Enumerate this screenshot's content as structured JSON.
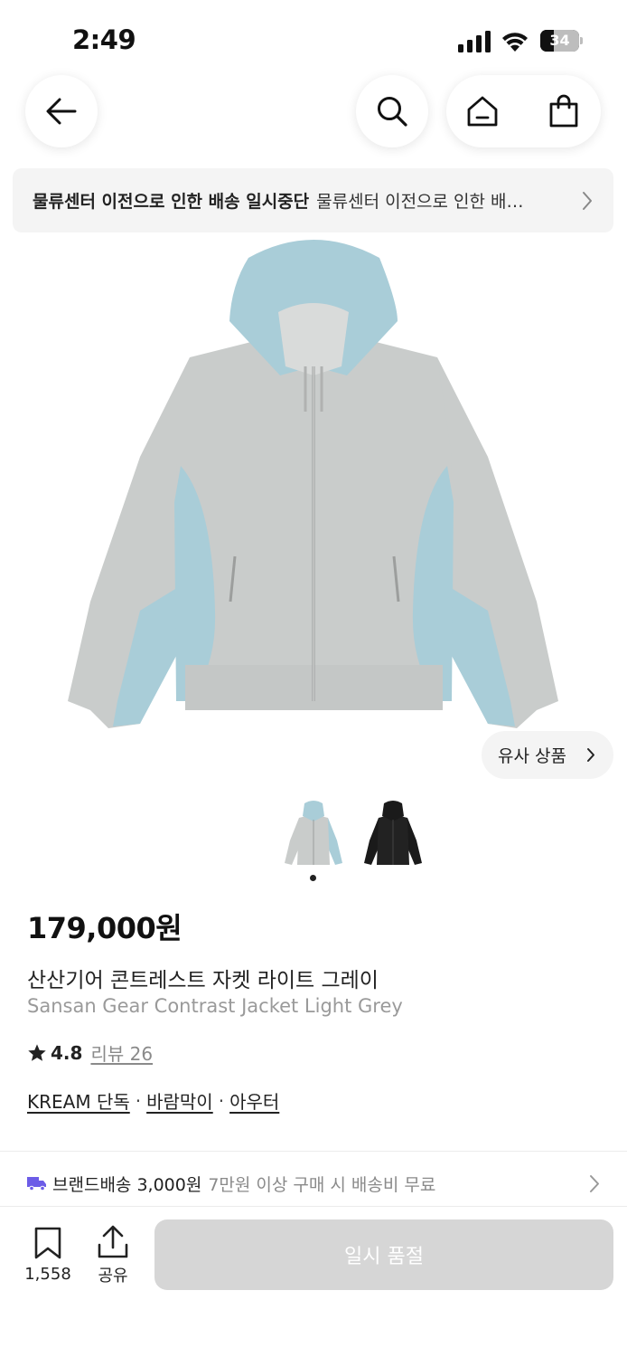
{
  "status_bar": {
    "time": "2:49",
    "battery": "34",
    "battery_level": 0.34
  },
  "nav": {
    "back_icon": "arrow-left-icon",
    "search_icon": "search-icon",
    "home_icon": "home-icon",
    "bag_icon": "shopping-bag-icon"
  },
  "notice": {
    "title": "물류센터 이전으로 인한 배송 일시중단",
    "description": "물류센터 이전으로 인한 배송 일시중단 안내"
  },
  "product": {
    "similar_label": "유사 상품",
    "image_colors": {
      "grey": "#c9cccb",
      "blue": "#a9cdd8",
      "black": "#1a1a1a"
    },
    "price": "179,000원",
    "name_ko": "산산기어 콘트레스트 자켓 라이트 그레이",
    "name_en": "Sansan Gear Contrast Jacket Light Grey",
    "rating": "4.8",
    "review_label": "리뷰 26",
    "tags": [
      "KREAM 단독",
      "바람막이",
      "아우터"
    ],
    "tag_separator": "·"
  },
  "shipping": {
    "label": "브랜드배송 3,000원",
    "note": "7만원 이상 구매 시 배송비 무료",
    "icon_color": "#6c5ce7"
  },
  "bottom": {
    "bookmark_count": "1,558",
    "share_label": "공유",
    "action_label": "일시 품절"
  }
}
